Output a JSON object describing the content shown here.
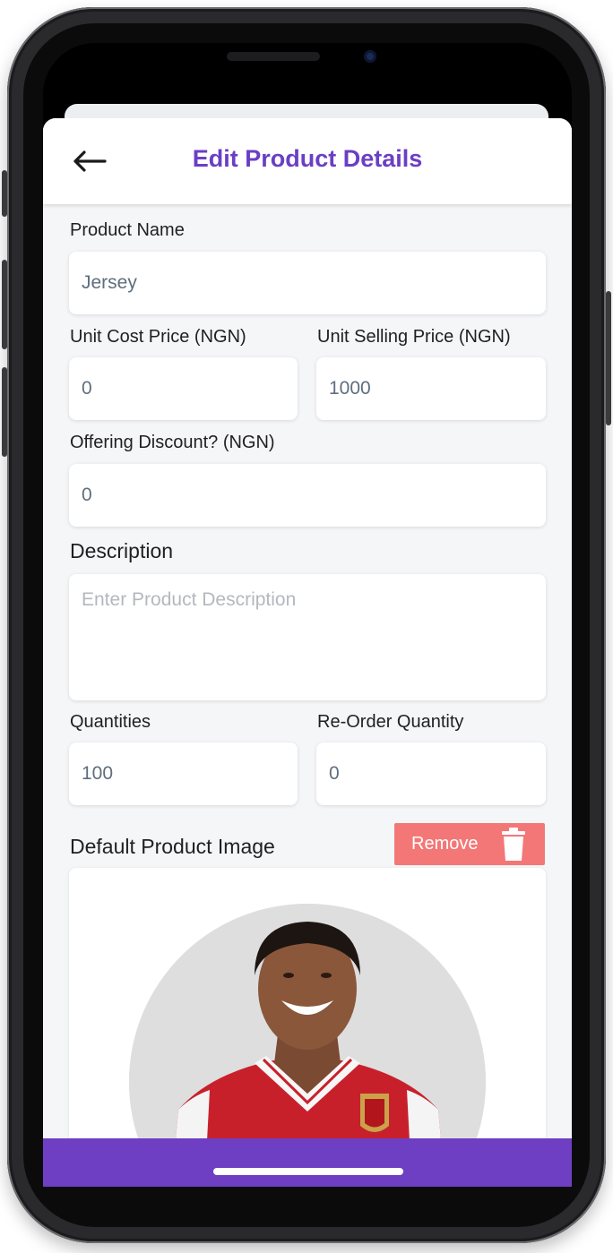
{
  "header": {
    "title": "Edit Product Details",
    "back_icon": "arrow-left-icon"
  },
  "form": {
    "product_name": {
      "label": "Product Name",
      "value": "Jersey"
    },
    "unit_cost_price": {
      "label": "Unit Cost Price (NGN)",
      "value": "0"
    },
    "unit_selling_price": {
      "label": "Unit Selling Price (NGN)",
      "value": "1000"
    },
    "offering_discount": {
      "label": "Offering Discount? (NGN)",
      "value": "0"
    },
    "description": {
      "label": "Description",
      "value": "",
      "placeholder": "Enter Product Description"
    },
    "quantities": {
      "label": "Quantities",
      "value": "100"
    },
    "reorder_quantity": {
      "label": "Re-Order Quantity",
      "value": "0"
    }
  },
  "image_section": {
    "label": "Default Product Image",
    "remove_label": "Remove",
    "remove_icon": "trash-icon"
  },
  "colors": {
    "accent": "#6b3fc4",
    "bottom_bar": "#6e3fc2",
    "remove_button": "#f37777",
    "background": "#f5f6f8"
  }
}
